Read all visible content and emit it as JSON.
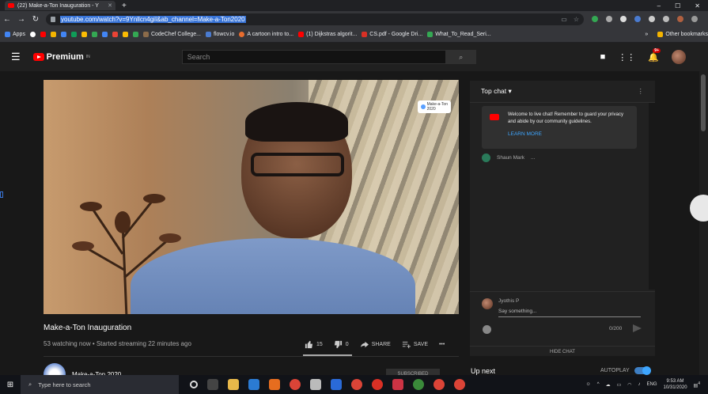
{
  "browser": {
    "tab_title": "(22) Make-a-Ton Inauguration - Y",
    "url": "youtube.com/watch?v=9Ynllcn4giI&ab_channel=Make-a-Ton2020",
    "new_tab_symbol": "+",
    "window_controls": [
      "–",
      "☐",
      "✕"
    ]
  },
  "bookmarks": {
    "items": [
      {
        "label": "Apps",
        "color": "#4285f4"
      },
      {
        "label": "",
        "color": "#ffffff"
      },
      {
        "label": "",
        "color": "#ff0000"
      },
      {
        "label": "",
        "color": "#f4b400"
      },
      {
        "label": "",
        "color": "#4285f4"
      },
      {
        "label": "",
        "color": "#0f9d58"
      },
      {
        "label": "",
        "color": "#fbbc04"
      },
      {
        "label": "",
        "color": "#34a853"
      },
      {
        "label": "",
        "color": "#4285f4"
      },
      {
        "label": "",
        "color": "#ea4335"
      },
      {
        "label": "",
        "color": "#fbbc04"
      },
      {
        "label": "",
        "color": "#34a853"
      },
      {
        "label": "CodeChef College...",
        "color": "#8b6b4a"
      },
      {
        "label": "flowcv.io",
        "color": "#4a7bd0"
      },
      {
        "label": "A cartoon intro to...",
        "color": "#e96d2e"
      },
      {
        "label": "(1) Dijkstras algorit...",
        "color": "#ff0000"
      },
      {
        "label": "CS.pdf - Google Dri...",
        "color": "#d93025"
      },
      {
        "label": "What_To_Read_Seri...",
        "color": "#34a853"
      }
    ],
    "more": "»",
    "other": "Other bookmarks"
  },
  "youtube": {
    "logo_text": "Premium",
    "logo_sup": "IN",
    "search_placeholder": "Search",
    "notification_count": "9+"
  },
  "video": {
    "overlay_badge": "Make-a-Ton",
    "overlay_sub": "2020",
    "title": "Make-a-Ton Inauguration",
    "meta": "53 watching now • Started streaming 22 minutes ago",
    "likes": "15",
    "dislikes": "0",
    "share_label": "SHARE",
    "save_label": "SAVE",
    "more": "•••"
  },
  "channel": {
    "name": "Make-a-Ton 2020",
    "subscribe_label": "SUBSCRIBED"
  },
  "chat": {
    "header": "Top chat",
    "welcome": "Welcome to live chat! Remember to guard your privacy and abide by our community guidelines.",
    "learn_more": "LEARN MORE",
    "messages": [
      {
        "author": "Shaun Mark",
        "text": "..."
      }
    ],
    "current_user": "Jyothis P",
    "input_placeholder": "Say something...",
    "char_counter": "0/200",
    "hide_chat": "HIDE CHAT"
  },
  "sidebar": {
    "up_next": "Up next",
    "autoplay": "AUTOPLAY",
    "autoplay_on": true
  },
  "taskbar": {
    "search_placeholder": "Type here to search",
    "language": "ENG",
    "time": "9:53 AM",
    "date": "10/31/2020",
    "notification_count": "4"
  }
}
